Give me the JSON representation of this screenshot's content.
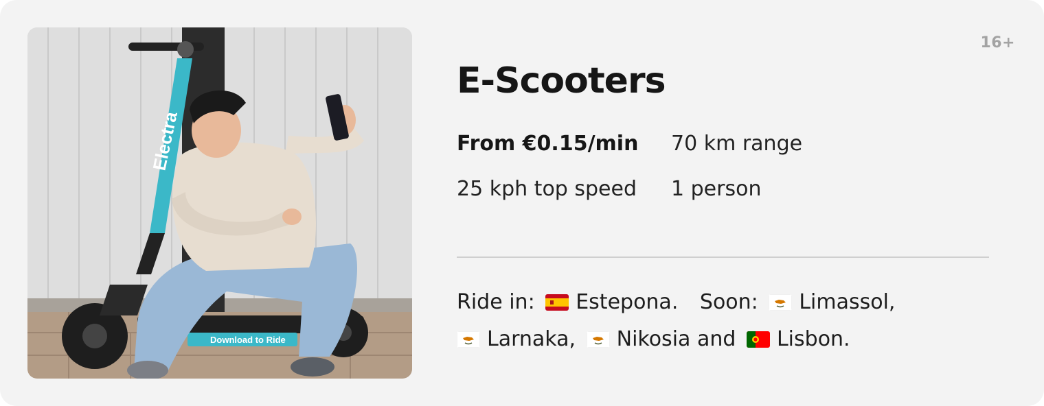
{
  "card": {
    "title": "E-Scooters",
    "age_badge": "16+",
    "specs": {
      "price": "From €0.15/min",
      "range": "70 km range",
      "top_speed": "25 kph top speed",
      "capacity": "1 person"
    },
    "cities": {
      "ride_in_label": "Ride in:",
      "ride_in_city": "Estepona.",
      "soon_label": "Soon:",
      "soon_cities": [
        {
          "name": "Limassol,",
          "flag": "cyprus-flag-icon"
        },
        {
          "name": "Larnaka,",
          "flag": "cyprus-flag-icon"
        },
        {
          "name": "Nikosia",
          "flag": "cyprus-flag-icon"
        },
        {
          "name": "Lisbon.",
          "flag": "portugal-flag-icon"
        }
      ],
      "and_word": "and"
    },
    "photo": {
      "scooter_brand": "Electra",
      "deck_text": "Download to Ride"
    }
  },
  "colors": {
    "card_background": "#f3f3f3",
    "scooter_accent": "#3bb8c8",
    "title": "#161616",
    "badge": "#a3a3a3"
  }
}
